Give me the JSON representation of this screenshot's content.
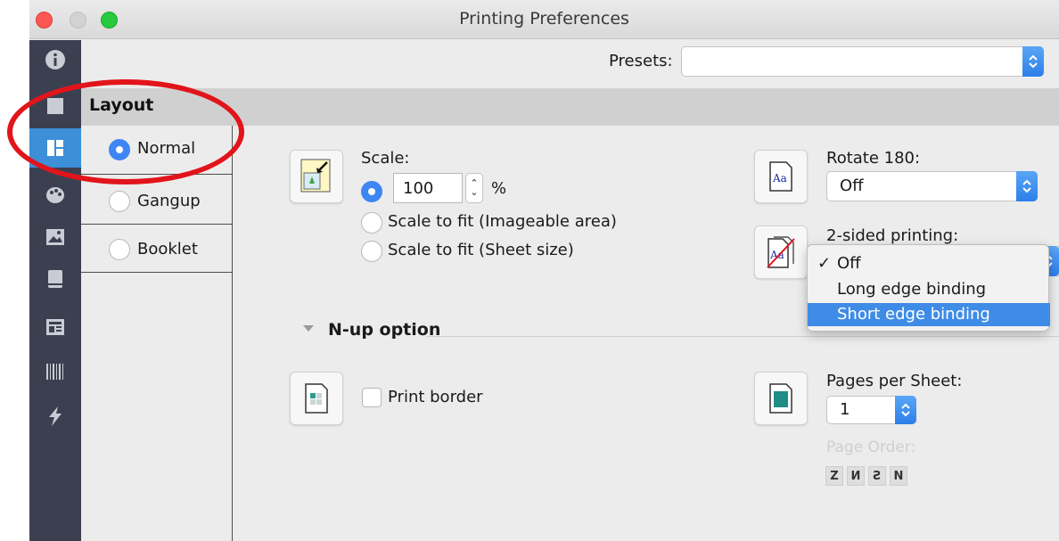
{
  "window": {
    "title": "Printing Preferences"
  },
  "toolbar": {
    "presets_label": "Presets:",
    "presets_value": ""
  },
  "section": {
    "title": "Layout"
  },
  "layout_options": [
    {
      "label": "Normal",
      "selected": true
    },
    {
      "label": "Gangup",
      "selected": false
    },
    {
      "label": "Booklet",
      "selected": false
    }
  ],
  "scale": {
    "label": "Scale:",
    "value": "100",
    "unit": "%",
    "fit_imageable": "Scale to fit (Imageable area)",
    "fit_sheet": "Scale to fit (Sheet size)"
  },
  "rotate": {
    "label": "Rotate 180:",
    "value": "Off"
  },
  "two_sided": {
    "label": "2-sided printing:",
    "options": [
      "Off",
      "Long edge binding",
      "Short edge binding"
    ],
    "checked": "Off",
    "highlighted": "Short edge binding",
    "check_mark": "✓"
  },
  "nup": {
    "title": "N-up option",
    "print_border": "Print border",
    "pages_per_sheet_label": "Pages per Sheet:",
    "pages_per_sheet_value": "1",
    "page_order_label": "Page Order:"
  },
  "icons": {
    "sidebar": [
      "info-icon",
      "document-icon",
      "layout-icon",
      "palette-icon",
      "image-icon",
      "book-icon",
      "newspaper-icon",
      "barcode-icon",
      "lightning-icon"
    ]
  },
  "colors": {
    "accent": "#3d86f4",
    "sidebar": "#3b4051",
    "highlight": "#3f8ce6",
    "annotation": "#e2141b"
  }
}
